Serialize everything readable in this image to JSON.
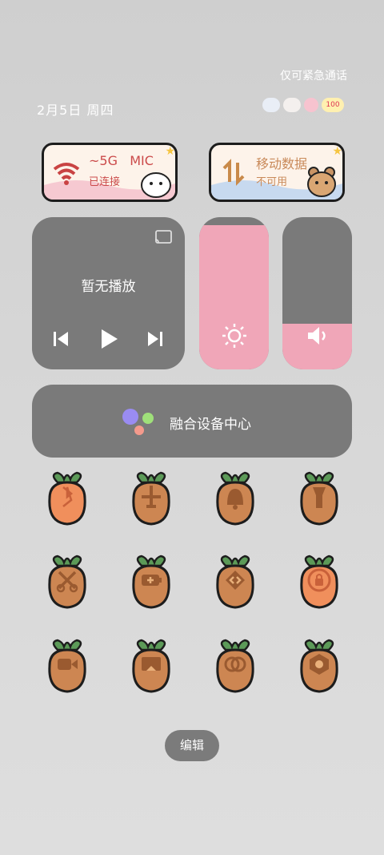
{
  "status": {
    "emergency_only": "仅可紧急通话",
    "date": "2月5日 周四"
  },
  "status_icons": [
    "cloud-icon",
    "cloud-icon",
    "flower-icon",
    "battery-icon"
  ],
  "battery": "100",
  "wifi_card": {
    "title": "~5G",
    "title_extra": "MIC",
    "subtitle": "已连接"
  },
  "data_card": {
    "title": "移动数据",
    "subtitle": "不可用"
  },
  "media": {
    "now_playing": "暂无播放"
  },
  "brightness": {
    "level": 0.95
  },
  "volume": {
    "level": 0.3
  },
  "fusion": {
    "label": "融合设备中心"
  },
  "tiles": [
    [
      "bluetooth-icon",
      "airplane-icon",
      "bell-icon",
      "flashlight-icon"
    ],
    [
      "screenshot-icon",
      "battery-saver-icon",
      "nearby-share-icon",
      "rotation-lock-icon"
    ],
    [
      "screen-record-icon",
      "screen-cast-icon",
      "cloud-share-icon",
      "camera-icon"
    ]
  ],
  "tile_active": [
    true,
    false,
    false,
    false,
    false,
    false,
    false,
    true,
    false,
    false,
    false,
    false
  ],
  "colors": {
    "tile_active": "#f08f5c",
    "tile_default": "#cd8652",
    "leaf": "#5c9a58",
    "pink": "#f0a6b8",
    "panel": "#7a7a7a"
  },
  "edit_label": "编辑"
}
